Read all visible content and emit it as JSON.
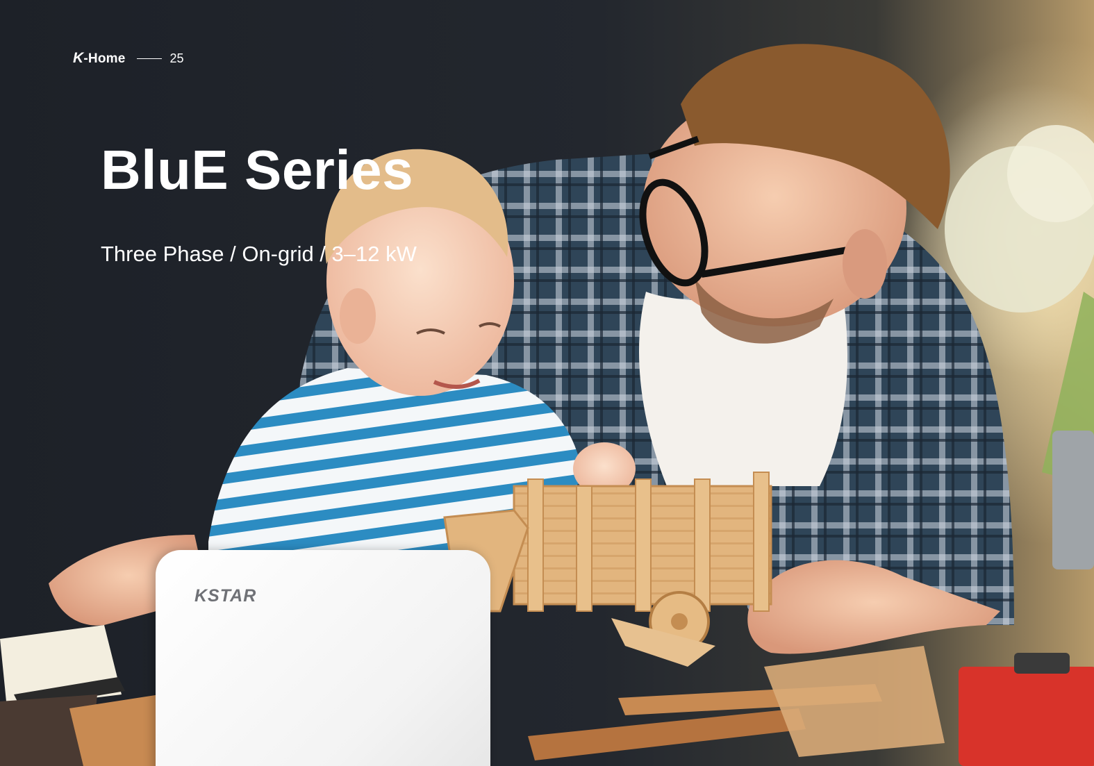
{
  "header": {
    "brand_k": "K",
    "brand_rest": "-Home",
    "page_number": "25"
  },
  "title": "BluE Series",
  "subtitle": "Three Phase / On-grid / 3–12 kW",
  "product": {
    "logo_text": "KSTAR"
  },
  "colors": {
    "background_dark": "#1e2229",
    "text": "#ffffff",
    "inverter_body": "#f3f3f3",
    "inverter_logo": "#6f7176"
  },
  "photo": {
    "subjects": [
      "man-icon",
      "child-icon",
      "wooden-truck-icon",
      "plant-icon"
    ]
  }
}
